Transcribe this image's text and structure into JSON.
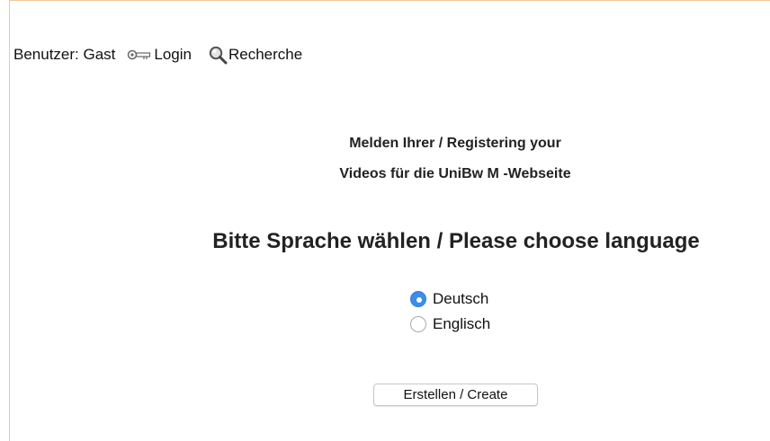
{
  "header": {
    "user_label": "Benutzer: Gast",
    "login_label": "Login",
    "search_label": "Recherche"
  },
  "intro": {
    "line1": "Melden Ihrer / Registering your",
    "line2": "Videos für die UniBw M -Webseite"
  },
  "language": {
    "title": "Bitte Sprache wählen / Please choose language",
    "options": [
      {
        "label": "Deutsch",
        "selected": true
      },
      {
        "label": "Englisch",
        "selected": false
      }
    ]
  },
  "actions": {
    "create_label": "Erstellen / Create"
  },
  "colors": {
    "accent": "#3b8eea",
    "frame_border": "#f2c79a"
  },
  "icons": {
    "login": "key-icon",
    "search": "search-icon"
  }
}
